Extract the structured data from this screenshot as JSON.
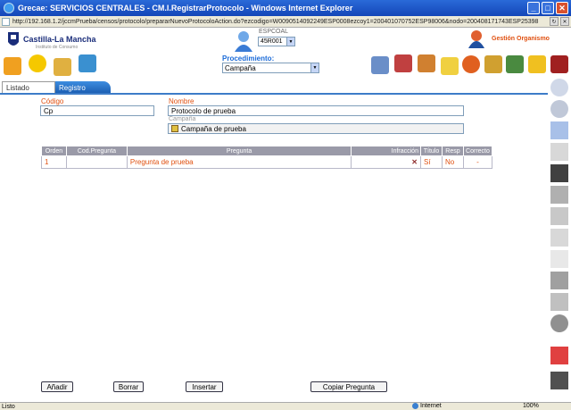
{
  "window": {
    "title": "Grecae: SERVICIOS CENTRALES - CM.I.RegistrarProtocolo - Windows Internet Explorer",
    "url": "http://192.168.1.2/jccmPrueba/censos/protocolo/prepararNuevoProtocoloAction.do?ezcodigo=W0090514092249ESP0008ezcoy1=200401070752ESP98006&nodo=200408171743ESP25398"
  },
  "header": {
    "logo_text": "Castilla-La Mancha",
    "logo_sub": "Instituto de Consumo",
    "esp_label": "ESPCOAL",
    "esp_value": "45R001",
    "org_label": "Gestión Organismo",
    "procedimiento_label": "Procedimiento:",
    "procedimiento_value": "Campaña"
  },
  "tabs": [
    {
      "label": "Listado"
    },
    {
      "label": "Registro"
    }
  ],
  "form": {
    "codigo_label": "Código",
    "codigo_value": "Cp",
    "nombre_label": "Nombre",
    "nombre_value": "Protocolo de prueba",
    "campana_label": "Campaña",
    "campana_value": "Campaña de prueba"
  },
  "grid": {
    "headers": [
      "Orden",
      "Cod.Pregunta",
      "Pregunta",
      "Infracción",
      "Título",
      "Resp",
      "Correcto"
    ],
    "rows": [
      {
        "orden": "1",
        "cod": "",
        "pregunta": "Pregunta de prueba",
        "infraccion": "",
        "titulo": "Sí",
        "resp": "No",
        "correcto": "-"
      }
    ]
  },
  "buttons": {
    "anadir": "Añadir",
    "borrar": "Borrar",
    "insertar": "Insertar",
    "copiar": "Copiar Pregunta"
  },
  "status": {
    "text": "Listo",
    "zone": "Internet",
    "zoom": "100%"
  },
  "colors": {
    "accent": "#e05010",
    "tab_active": "#2a72cc",
    "grid_header": "#9a9aa8"
  }
}
